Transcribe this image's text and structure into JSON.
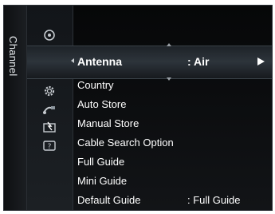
{
  "sidebar": {
    "label": "Channel"
  },
  "icons": [
    {
      "name": "picture-icon"
    },
    {
      "name": "channel-satellite-icon"
    },
    {
      "name": "setup-gear-icon"
    },
    {
      "name": "input-icon"
    },
    {
      "name": "application-icon"
    },
    {
      "name": "support-icon"
    }
  ],
  "menu": {
    "selected": {
      "label": "Antenna",
      "value": ": Air"
    },
    "items": [
      {
        "label": "Country",
        "value": ""
      },
      {
        "label": "Auto Store",
        "value": ""
      },
      {
        "label": "Manual Store",
        "value": ""
      },
      {
        "label": "Cable Search Option",
        "value": ""
      },
      {
        "label": "Full Guide",
        "value": ""
      },
      {
        "label": "Mini Guide",
        "value": ""
      },
      {
        "label": "Default Guide",
        "value": ": Full Guide"
      }
    ]
  },
  "colors": {
    "background": "#0b0d10",
    "text": "#ffffff",
    "highlight": "#2d343b"
  }
}
